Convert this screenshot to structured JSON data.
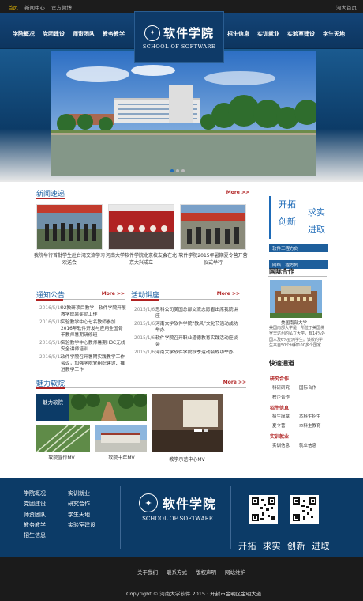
{
  "topbar": {
    "links": [
      "首页",
      "新闻中心",
      "官方微博"
    ],
    "right": "河大首页"
  },
  "nav": {
    "left": [
      "学院概况",
      "党团建设",
      "师资团队",
      "教务教学"
    ],
    "right": [
      "招生信息",
      "实训就业",
      "实验室建设",
      "学生天地"
    ],
    "logo_cn": "软件学院",
    "logo_en": "SCHOOL OF SOFTWARE"
  },
  "news": {
    "title": "新闻速递",
    "more": "More >>",
    "items": [
      {
        "caption": "我院举行首批学生赴台湾交流学习欢送会"
      },
      {
        "caption": "河南大学软件学院北京校友会在北京大兴成立"
      },
      {
        "caption": "软件学院2015年暑期夏令营开营仪式举行"
      }
    ]
  },
  "notice": {
    "title": "通知公告",
    "more": "More >>",
    "items": [
      {
        "date": "2016/5/19",
        "text": "02教研项目教学，软件学院开展教学成果奖励工作"
      },
      {
        "date": "2016/5/18",
        "text": "实验教学中心七名教师参加2016年软件开发与应用全国骨干教师暑期研修班"
      },
      {
        "date": "2016/5/16",
        "text": "实验教学中心教师暑期H3C无线安全讲师培训"
      },
      {
        "date": "2016/5/12",
        "text": "软件学院召开暑期实践教学工作会议，加强学院党组织建设、推进教学工作"
      }
    ]
  },
  "lecture": {
    "title": "活动讲座",
    "more": "More >>",
    "items": [
      {
        "date": "2015/1/6",
        "text": "思科公司美国总部交流志愿者出席我院讲座"
      },
      {
        "date": "2015/1/6",
        "text": "河南大学软件学院“教风”文化节活动成功举办"
      },
      {
        "date": "2015/1/6",
        "text": "软件学院召开职业道德教育实践活动座谈会"
      },
      {
        "date": "2015/1/6",
        "text": "河南大学软件学院秋季运动会成功举办"
      }
    ]
  },
  "charm": {
    "title": "魅力软院",
    "more": "More >>",
    "feature_label": "魅力软院",
    "captions": [
      "软院宣传MV",
      "软院十年MV",
      "教学示范中心MV"
    ]
  },
  "side": {
    "slogan": [
      "开拓",
      "求实",
      "创新",
      "进取"
    ],
    "tags": [
      "软件工程方向",
      "网络工程方向"
    ],
    "intl_title": "国际合作",
    "intl_caption": "美国南部大学",
    "intl_text": "美国南部大学是一所位于美国佛罗里达州的私立大学，有14%外国人及6%亚洲学生。该校的学生来自50个州和100多个国家...",
    "quick_title": "快速通道",
    "groups": [
      {
        "title": "研究合作",
        "links": [
          "科研研究",
          "国际合作",
          "校企合作"
        ]
      },
      {
        "title": "招生信息",
        "links": [
          "招生简章",
          "本科生招生",
          "夏令营",
          "本科生教育"
        ]
      },
      {
        "title": "实训就业",
        "links": [
          "实训信息",
          "就业信息"
        ]
      }
    ]
  },
  "footer": {
    "col1": [
      "学院概况",
      "党团建设",
      "师资团队",
      "教务教学",
      "招生信息"
    ],
    "col2": [
      "实训就业",
      "研究合作",
      "学生天地",
      "实验室建设"
    ],
    "slogan": "开拓  求实  创新  进取",
    "bottom_links": [
      "关于我们",
      "联系方式",
      "版权声明",
      "网站维护"
    ],
    "copyright": "Copyright  ©  河南大学软件  2015  · 开封市金明区金明大道"
  },
  "colors": {
    "primary": "#0c3b67",
    "accent": "#b02222",
    "link": "#1e6bb8"
  }
}
